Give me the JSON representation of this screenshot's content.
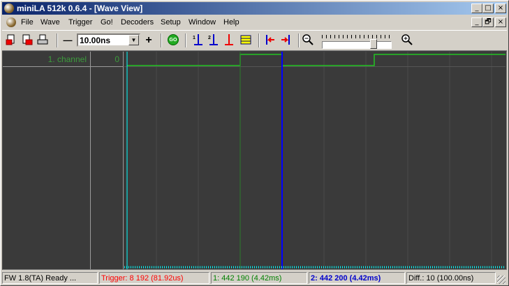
{
  "window": {
    "title": "miniLA 512k 0.6.4 - [Wave View]",
    "controls": {
      "minimize": "_",
      "maximize": "□",
      "close": "×",
      "restore": "🗗"
    }
  },
  "menu": {
    "items": [
      "File",
      "Wave",
      "Trigger",
      "Go!",
      "Decoders",
      "Setup",
      "Window",
      "Help"
    ]
  },
  "toolbar": {
    "zoom_out_label": "—",
    "timebase_value": "10.00ns",
    "zoom_in_label": "+",
    "go_label": "GO",
    "cursor1_label": "1",
    "cursor2_label": "2",
    "slider_position": 0.77
  },
  "channels": [
    {
      "name": "1. channel",
      "value": "0"
    }
  ],
  "colors": {
    "signal": "#22c322",
    "cursor1": "#2b7a2b",
    "cursor2": "#0000ff",
    "trigger": "#00ffff",
    "status_trigger": "#ff0000",
    "status_cursor1": "#008000",
    "status_cursor2": "#0000cc"
  },
  "status": {
    "fw": "FW 1.8(TA) Ready ...",
    "trigger": "Trigger: 8 192  (81.92us)",
    "cursor1": "1: 442 190  (4.42ms)",
    "cursor2": "2: 442 200  (4.42ms)",
    "diff": "Diff.: 10  (100.00ns)"
  }
}
